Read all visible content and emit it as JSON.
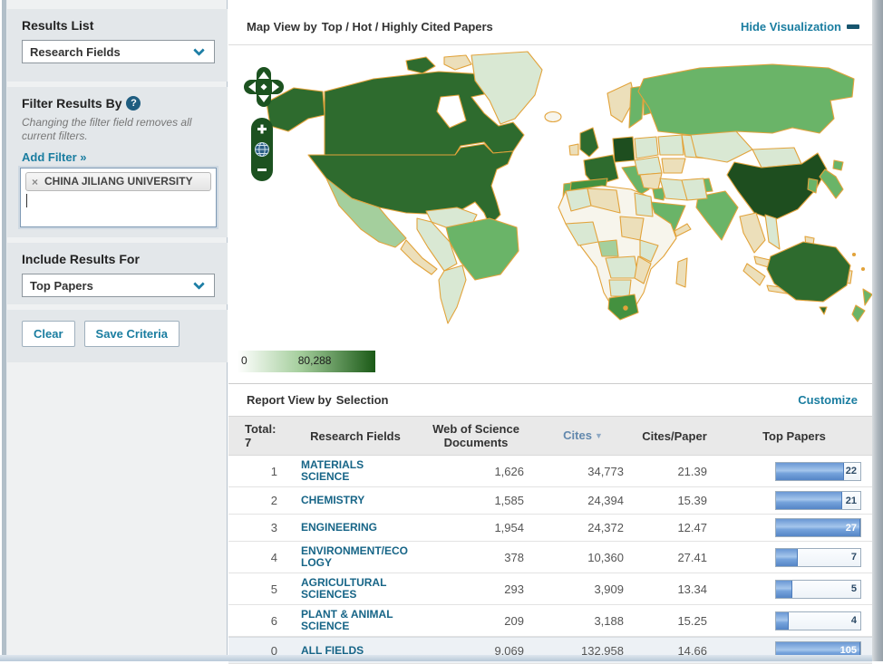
{
  "sidebar": {
    "results_list": {
      "label": "Results List",
      "dropdown_value": "Research Fields"
    },
    "filter": {
      "label": "Filter Results By",
      "help_icon": "?",
      "note": "Changing the filter field removes all current filters.",
      "add_filter_label": "Add Filter »",
      "tag": {
        "remove_icon": "×",
        "label": "CHINA JILIANG UNIVERSITY"
      },
      "input_value": ""
    },
    "include_results": {
      "label": "Include Results For",
      "dropdown_value": "Top Papers"
    },
    "buttons": {
      "clear": "Clear",
      "save": "Save Criteria"
    }
  },
  "map_section": {
    "title_prefix": "Map View by",
    "title": "Top / Hot / Highly Cited Papers",
    "hide_label": "Hide Visualization",
    "legend": {
      "min": "0",
      "max": "80,288"
    },
    "controls": {
      "zoom_in": "+",
      "zoom_out": "−"
    }
  },
  "report_section": {
    "title_prefix": "Report View by",
    "title": "Selection",
    "customize_label": "Customize",
    "table": {
      "header": {
        "total_label": "Total:",
        "total_value": "7",
        "research_fields": "Research Fields",
        "documents": "Web of Science Documents",
        "cites": "Cites",
        "sort_arrow": "▼",
        "cites_per_paper": "Cites/Paper",
        "top_papers": "Top Papers"
      },
      "rows": [
        {
          "rank": "1",
          "field": "MATERIALS SCIENCE",
          "documents": "1,626",
          "cites": "34,773",
          "cites_per_paper": "21.39",
          "top_papers": "22",
          "bar_pct": 81,
          "highlight": false
        },
        {
          "rank": "2",
          "field": "CHEMISTRY",
          "documents": "1,585",
          "cites": "24,394",
          "cites_per_paper": "15.39",
          "top_papers": "21",
          "bar_pct": 78,
          "highlight": false
        },
        {
          "rank": "3",
          "field": "ENGINEERING",
          "documents": "1,954",
          "cites": "24,372",
          "cites_per_paper": "12.47",
          "top_papers": "27",
          "bar_pct": 100,
          "highlight": false
        },
        {
          "rank": "4",
          "field": "ENVIRONMENT/ECOLOGY",
          "documents": "378",
          "cites": "10,360",
          "cites_per_paper": "27.41",
          "top_papers": "7",
          "bar_pct": 26,
          "highlight": false
        },
        {
          "rank": "5",
          "field": "AGRICULTURAL SCIENCES",
          "documents": "293",
          "cites": "3,909",
          "cites_per_paper": "13.34",
          "top_papers": "5",
          "bar_pct": 19,
          "highlight": false
        },
        {
          "rank": "6",
          "field": "PLANT & ANIMAL SCIENCE",
          "documents": "209",
          "cites": "3,188",
          "cites_per_paper": "15.25",
          "top_papers": "4",
          "bar_pct": 15,
          "highlight": false
        },
        {
          "rank": "0",
          "field": "ALL FIELDS",
          "documents": "9,069",
          "cites": "132,958",
          "cites_per_paper": "14.66",
          "top_papers": "105",
          "bar_pct": 100,
          "highlight": true
        }
      ]
    }
  },
  "palette": {
    "country_darkest": "#1e4e1f",
    "country_dark": "#2e6b2e",
    "country_mid_dark": "#44913f",
    "country_mid": "#6ab468",
    "country_light": "#a4cf9d",
    "country_pale": "#d9e8d3",
    "country_tan": "#ecdfba",
    "country_near_white": "#f7f5ec",
    "map_border": "#e2a33b",
    "legend_start": "#ffffff",
    "legend_end": "#1b5a17",
    "link_teal": "#1a7da0",
    "bar_blue": "#6a97d4",
    "control_green": "#1c5220"
  }
}
